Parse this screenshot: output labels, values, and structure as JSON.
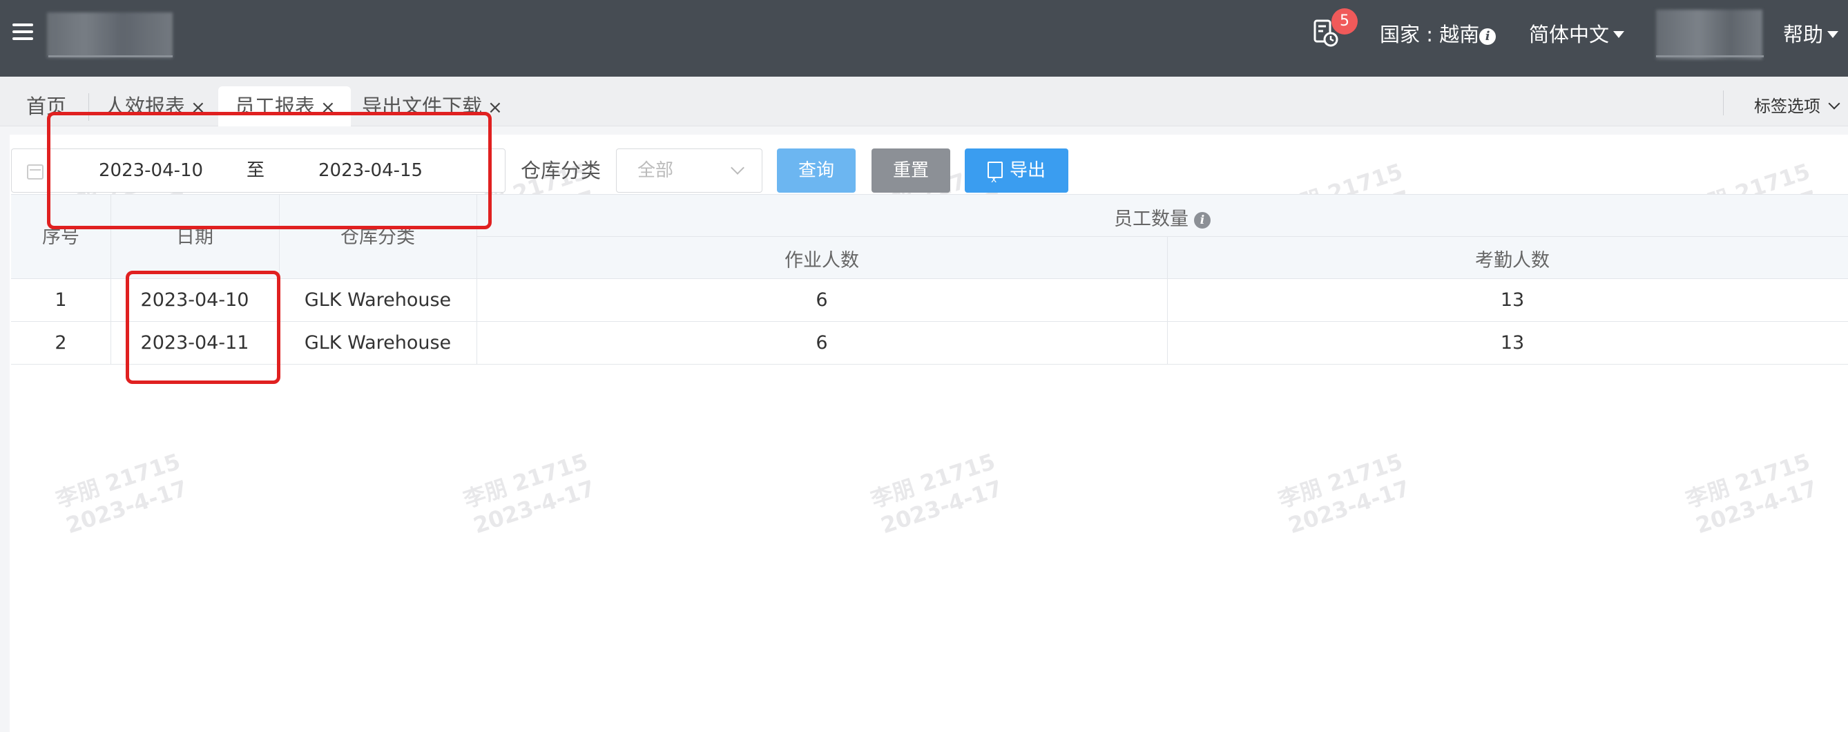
{
  "header": {
    "notification_count": "5",
    "country_label": "国家 : 越南",
    "language": "简体中文",
    "help": "帮助",
    "info_glyph": "i"
  },
  "tabs": [
    {
      "label": "首页",
      "closable": false
    },
    {
      "label": "人效报表",
      "closable": true
    },
    {
      "label": "员工报表",
      "closable": true,
      "active": true
    },
    {
      "label": "导出文件下载",
      "closable": true
    }
  ],
  "tab_close_glyph": "×",
  "tab_options": "标签选项",
  "filters": {
    "date_start": "2023-04-10",
    "date_to": "至",
    "date_end": "2023-04-15",
    "warehouse_label": "仓库分类",
    "warehouse_value": "全部",
    "query_button": "查询",
    "reset_button": "重置",
    "export_button": "导出"
  },
  "table": {
    "headers": {
      "index": "序号",
      "date": "日期",
      "warehouse": "仓库分类",
      "staff_group": "员工数量",
      "work_count": "作业人数",
      "attendance_count": "考勤人数"
    },
    "rows": [
      {
        "index": "1",
        "date": "2023-04-10",
        "warehouse": "GLK Warehouse",
        "work_count": "6",
        "attendance_count": "13"
      },
      {
        "index": "2",
        "date": "2023-04-11",
        "warehouse": "GLK Warehouse",
        "work_count": "6",
        "attendance_count": "13"
      }
    ]
  },
  "watermark": {
    "line1": "李朋 21715",
    "line2": "2023-4-17"
  },
  "colors": {
    "header_bg": "#464c53",
    "badge": "#f05a5a",
    "query_button": "#6cb6f1",
    "reset_button": "#8c9096",
    "export_button": "#3a9df0",
    "annotation": "#e02020"
  },
  "icons": [
    "menu-toggle-icon",
    "task-clock-icon",
    "info-icon",
    "caret-down-icon",
    "calendar-icon",
    "chevron-down-icon",
    "excel-icon",
    "close-icon"
  ]
}
